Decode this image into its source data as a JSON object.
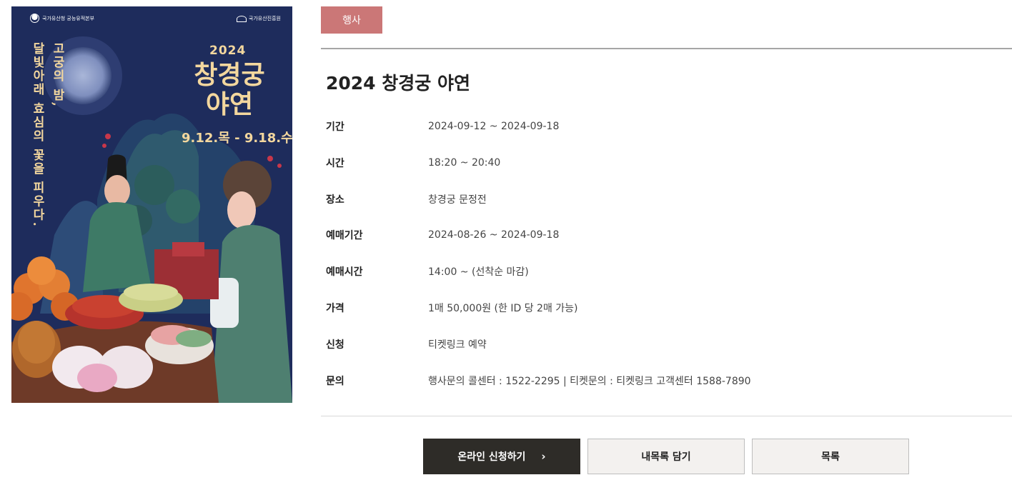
{
  "poster": {
    "org_left": "국가유산청 궁능유적본부",
    "org_right": "국가유산진흥원",
    "vertical_line1": "고궁의 밤,",
    "vertical_line2": "달빛아래 효심의 꽃을 피우다.",
    "year": "2024",
    "title_line1": "창경궁",
    "title_line2": "야연",
    "dates": "9.12.목 - 9.18.수"
  },
  "category_badge": "행사",
  "event": {
    "title": "2024 창경궁 야연",
    "rows": [
      {
        "label": "기간",
        "value": "2024-09-12 ~ 2024-09-18"
      },
      {
        "label": "시간",
        "value": "18:20 ~ 20:40"
      },
      {
        "label": "장소",
        "value": "창경궁 문정전"
      },
      {
        "label": "예매기간",
        "value": "2024-08-26 ~ 2024-09-18"
      },
      {
        "label": "예매시간",
        "value": "14:00 ~ (선착순 마감)"
      },
      {
        "label": "가격",
        "value": "1매 50,000원 (한 ID 당 2매 가능)"
      },
      {
        "label": "신청",
        "value": "티켓링크 예약"
      },
      {
        "label": "문의",
        "value": "행사문의 콜센터 : 1522-2295 | 티켓문의 : 티켓링크 고객센터 1588-7890"
      }
    ]
  },
  "buttons": {
    "apply": "온라인 신청하기",
    "save": "내목록 담기",
    "list": "목록"
  },
  "colors": {
    "badge": "#cb7777",
    "poster_bg": "#1e2c5c",
    "poster_text": "#f3d79e",
    "apply_button": "#2e2c28"
  },
  "icons": {
    "apply_chevron": "chevron-right-icon"
  }
}
